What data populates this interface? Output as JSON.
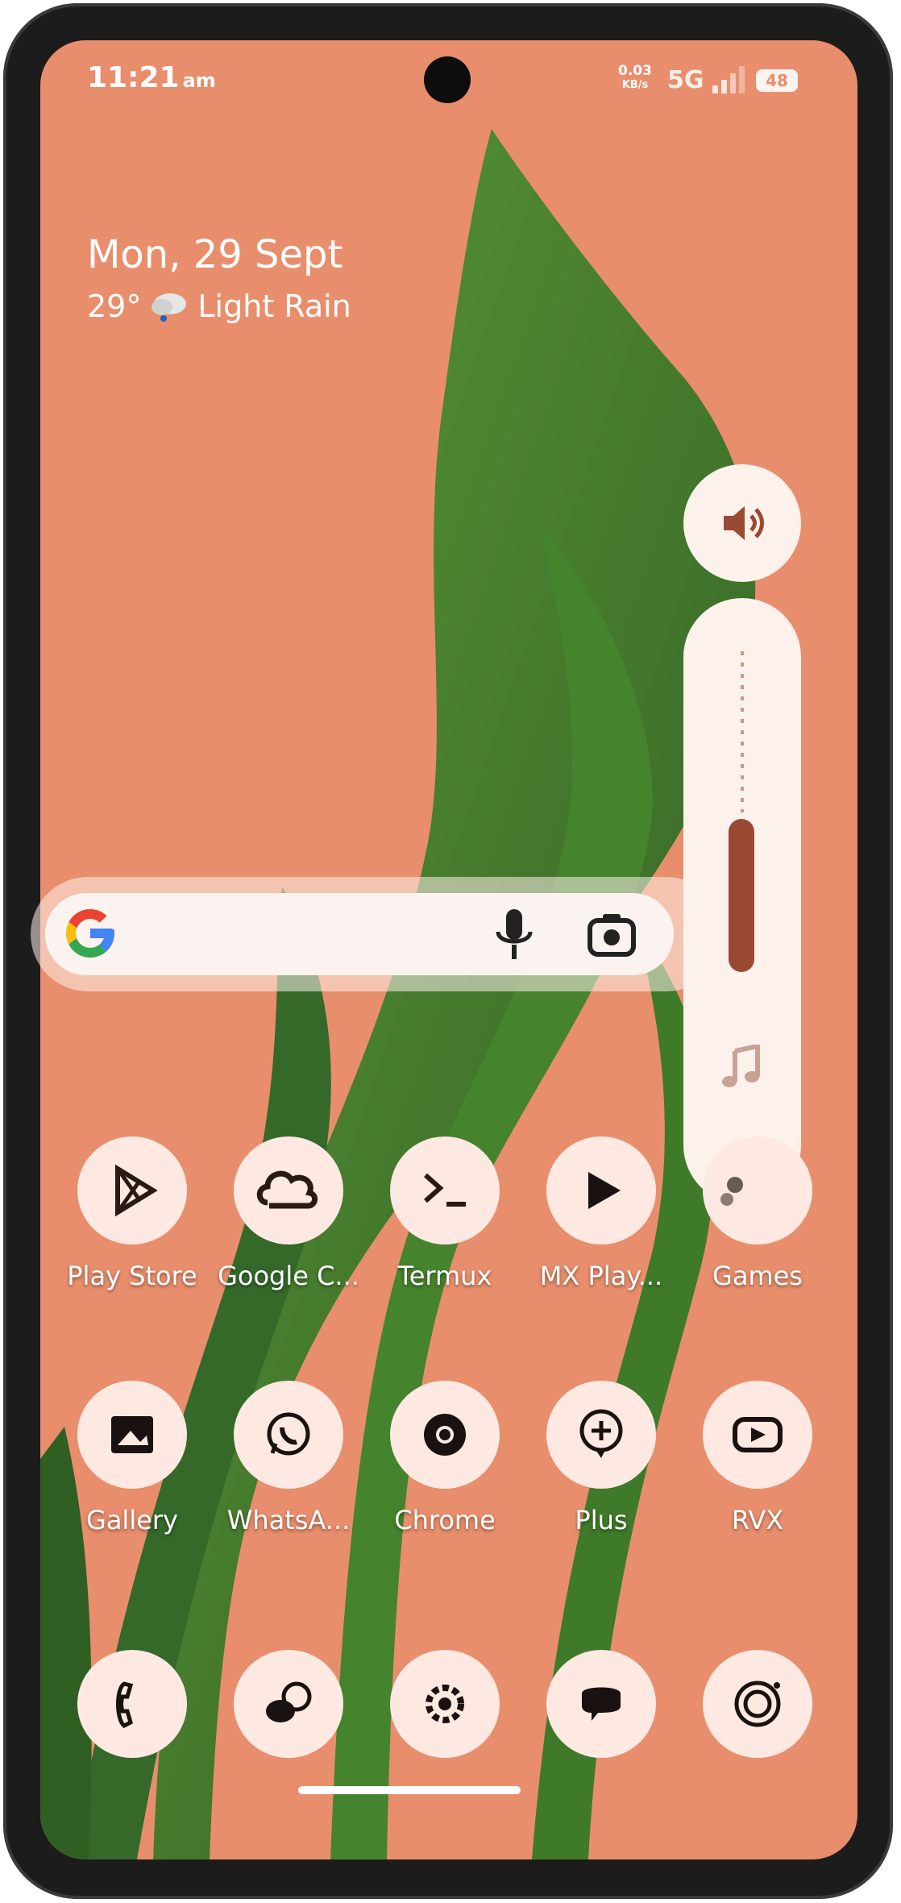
{
  "status_bar": {
    "time": "11:21",
    "ampm": "am",
    "net_speed": "0.03",
    "net_unit": "KB/s",
    "network": "5G",
    "battery": "48"
  },
  "widget": {
    "date": "Mon, 29 Sept",
    "temperature": "29°",
    "condition": "Light Rain"
  },
  "volume_panel": {
    "level": 0.35
  },
  "apps_row1": [
    {
      "label": "Play Store",
      "icon": "play-store-icon"
    },
    {
      "label": "Google C...",
      "icon": "cloud-icon"
    },
    {
      "label": "Termux",
      "icon": "terminal-icon"
    },
    {
      "label": "MX Play...",
      "icon": "play-icon"
    },
    {
      "label": "Games",
      "icon": "games-icon"
    }
  ],
  "apps_row2": [
    {
      "label": "Gallery",
      "icon": "gallery-icon"
    },
    {
      "label": "WhatsA...",
      "icon": "whatsapp-icon"
    },
    {
      "label": "Chrome",
      "icon": "chrome-icon"
    },
    {
      "label": "Plus",
      "icon": "plus-icon"
    },
    {
      "label": "RVX",
      "icon": "rvx-icon"
    }
  ],
  "dock": [
    {
      "icon": "phone-icon"
    },
    {
      "icon": "messages-bubbles-icon"
    },
    {
      "icon": "settings-icon"
    },
    {
      "icon": "chat-icon"
    },
    {
      "icon": "camera-icon"
    }
  ],
  "colors": {
    "wallpaper": "#e88e6c",
    "foliage": "#3f7a2a",
    "icon_bg": "#fde9e2",
    "accent": "#9a4a32"
  }
}
